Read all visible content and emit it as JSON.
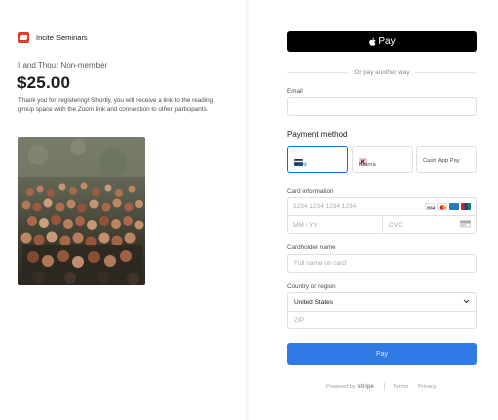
{
  "merchant": {
    "name": "Incite Seminars",
    "logo_icon": "incite-logo-icon",
    "brand_color": "#e0392b"
  },
  "product": {
    "name": "I and Thou: Non-member",
    "price": "$25.00",
    "description": "Thank you for registering! Shortly, you will receive a link to the reading group space with the Zoom link and connection to other participants."
  },
  "checkout": {
    "apple_pay_label": "Pay",
    "or_divider": "Or pay another way",
    "email_label": "Email",
    "email_value": "",
    "payment_method_title": "Payment method",
    "methods": [
      {
        "label": "Card",
        "icon": "card-icon",
        "selected": true
      },
      {
        "label": "Klarna",
        "icon": "klarna-icon",
        "selected": false
      },
      {
        "label": "Cash App Pay",
        "icon": "",
        "selected": false
      }
    ],
    "card_info_label": "Card information",
    "card_number_placeholder": "1234 1234 1234 1234",
    "expiry_placeholder": "MM / YY",
    "cvc_placeholder": "CVC",
    "card_brands": [
      "visa-icon",
      "mastercard-icon",
      "amex-icon",
      "unionpay-icon"
    ],
    "cardholder_label": "Cardholder name",
    "cardholder_placeholder": "Full name on card",
    "country_label": "Country or region",
    "country_value": "United States",
    "zip_placeholder": "ZIP",
    "pay_button": "Pay",
    "accent_color": "#0570de",
    "pay_button_color": "#2f7ae5"
  },
  "footer": {
    "powered_by": "Powered by",
    "stripe": "stripe",
    "terms": "Terms",
    "privacy": "Privacy"
  }
}
